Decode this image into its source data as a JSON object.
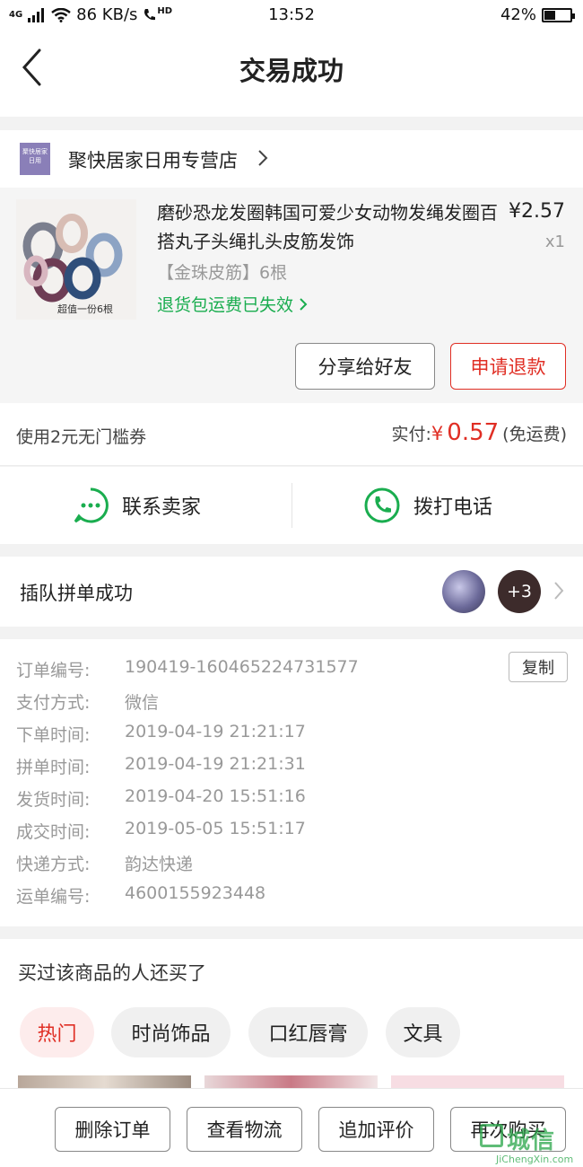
{
  "status_bar": {
    "network": "4G",
    "speed": "86 KB/s",
    "hd": "HD",
    "time": "13:52",
    "battery": "42%",
    "battery_level": 0.42
  },
  "nav": {
    "title": "交易成功"
  },
  "store": {
    "logo_text": "聚快居家日用",
    "name": "聚快居家日用专营店"
  },
  "product": {
    "title": "磨砂恐龙发圈韩国可爱少女动物发绳发圈百搭丸子头绳扎头皮筋发饰",
    "price": "¥2.57",
    "qty": "x1",
    "spec": "【金珠皮筋】6根",
    "shipping_note": "退货包运费已失效",
    "thumb_caption": "超值一份6根",
    "share_label": "分享给好友",
    "refund_label": "申请退款"
  },
  "payment": {
    "coupon": "使用2元无门槛券",
    "paid_label": "实付:",
    "currency": "¥",
    "amount": "0.57",
    "shipping": "(免运费)"
  },
  "contact": {
    "seller_label": "联系卖家",
    "call_label": "拨打电话"
  },
  "group": {
    "label": "插队拼单成功",
    "extra_count": "+3"
  },
  "details": {
    "copy_label": "复制",
    "rows": [
      {
        "k": "订单编号:",
        "v": "190419-160465224731577"
      },
      {
        "k": "支付方式:",
        "v": "微信"
      },
      {
        "k": "下单时间:",
        "v": "2019-04-19 21:21:17"
      },
      {
        "k": "拼单时间:",
        "v": "2019-04-19 21:21:31"
      },
      {
        "k": "发货时间:",
        "v": "2019-04-20 15:51:16"
      },
      {
        "k": "成交时间:",
        "v": "2019-05-05 15:51:17"
      },
      {
        "k": "快递方式:",
        "v": "韵达快递"
      },
      {
        "k": "运单编号:",
        "v": "4600155923448"
      }
    ]
  },
  "recommend": {
    "heading": "买过该商品的人还买了",
    "tabs": [
      "热门",
      "时尚饰品",
      "口红唇膏",
      "文具"
    ]
  },
  "bottom": {
    "delete_label": "删除订单",
    "logistics_label": "查看物流",
    "review_label": "追加评价",
    "rebuy_label": "再次购买"
  },
  "watermark": {
    "text": "城信",
    "url": "JiChengXin.com"
  }
}
